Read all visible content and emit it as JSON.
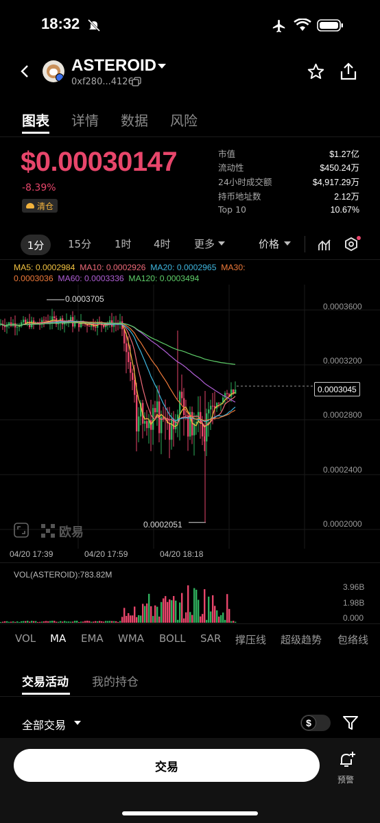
{
  "status": {
    "time": "18:32"
  },
  "header": {
    "title": "ASTEROID",
    "address": "0xf280...4126"
  },
  "tabs": [
    "图表",
    "详情",
    "数据",
    "风险"
  ],
  "price": {
    "value": "$0.00030147",
    "change": "-8.39%",
    "badge": "清仓"
  },
  "stats": [
    {
      "k": "市值",
      "v": "$1.27亿"
    },
    {
      "k": "流动性",
      "v": "$450.24万"
    },
    {
      "k": "24小时成交额",
      "v": "$4,917.29万"
    },
    {
      "k": "持币地址数",
      "v": "2.12万"
    },
    {
      "k": "Top 10",
      "v": "10.67%"
    }
  ],
  "timeframes": [
    "1分",
    "15分",
    "1时",
    "4时",
    "更多"
  ],
  "price_type": "价格",
  "ma_legend": {
    "ma5": "MA5: 0.0002984",
    "ma10": "MA10: 0.0002926",
    "ma20": "MA20: 0.0002965",
    "ma30": "MA30:",
    "ma30v": "0.0003036",
    "ma60": "MA60: 0.0003336",
    "ma120": "MA120: 0.0003494"
  },
  "colors": {
    "ma5": "#f5c542",
    "ma10": "#ef6b7a",
    "ma20": "#3fb7e0",
    "ma30": "#f07a3a",
    "ma60": "#b05fd6",
    "ma120": "#5fcf6a",
    "up": "#2fb05d",
    "down": "#e8466b"
  },
  "chart_data": {
    "type": "candlestick",
    "y_ticks": [
      "0.0003600",
      "0.0003200",
      "0.0002800",
      "0.0002400",
      "0.0002000"
    ],
    "high_label": "0.0003705",
    "low_label": "0.0002051",
    "current_label": "0.0003045",
    "x_ticks": [
      "04/20 17:39",
      "04/20 17:59",
      "04/20 18:18"
    ]
  },
  "volume": {
    "label": "VOL(ASTEROID):783.82M",
    "ticks": [
      "3.96B",
      "1.98B",
      "0.000"
    ]
  },
  "indicator_tabs": [
    "VOL",
    "MA",
    "EMA",
    "WMA",
    "BOLL",
    "SAR",
    "撑压线",
    "超级趋势",
    "包络线"
  ],
  "activity_tabs": [
    "交易活动",
    "我的持仓"
  ],
  "filter": {
    "all_trades": "全部交易",
    "currency": "$"
  },
  "brand": "欧易",
  "bottom": {
    "trade": "交易",
    "alert": "预警"
  }
}
